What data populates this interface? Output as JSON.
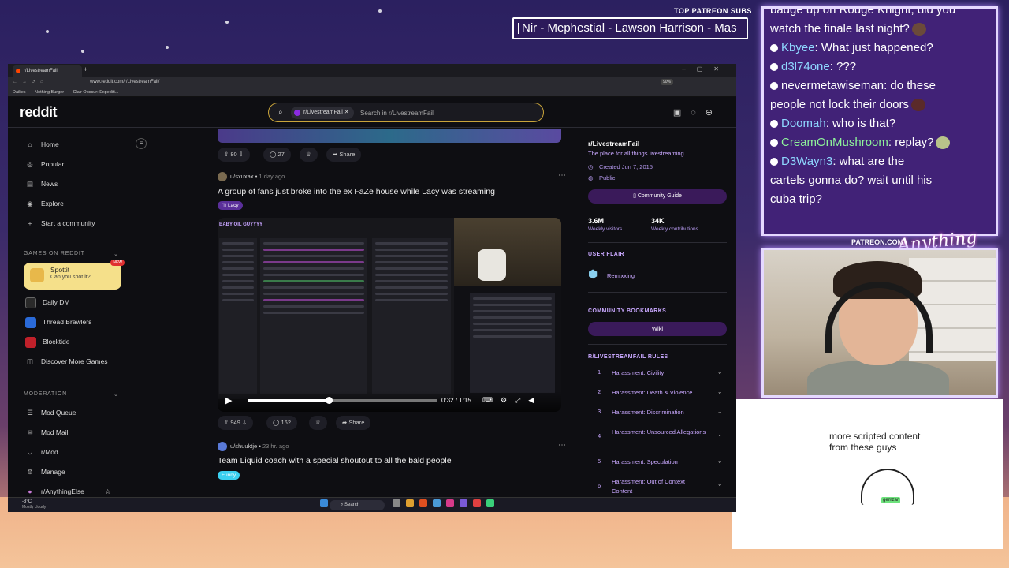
{
  "overlay": {
    "patreon_subs_title": "TOP PATREON SUBS",
    "ticker": "Nir - Mephestial - Lawson Harrison - Mas",
    "patreon_link": "PATREON.COM/",
    "brand_script": "Anything Else"
  },
  "chat": {
    "top_line": "badge up on Rouge Knight, did you",
    "messages": [
      {
        "user": "",
        "text": "watch the finale last night?",
        "color": "#ffffff",
        "emote_color": "#6b4a3a"
      },
      {
        "user": "Kbyee",
        "text": "What just happened?",
        "color": "#8fd8ff",
        "emote_color": ""
      },
      {
        "user": "d3l74one",
        "text": "???",
        "color": "#8fd8ff",
        "emote_color": ""
      },
      {
        "user": "nevermetawiseman",
        "text": "do these",
        "color": "#ffffff",
        "emote_color": ""
      },
      {
        "user": "",
        "text": "people not lock their doors",
        "color": "#ffffff",
        "emote_color": "#5a2a2a"
      },
      {
        "user": "Doomah",
        "text": "who is that?",
        "color": "#8fd8ff",
        "emote_color": ""
      },
      {
        "user": "CreamOnMushroom",
        "text": "replay?",
        "color": "#8ef39a",
        "emote_color": "#b8c28a"
      },
      {
        "user": "D3Wayn3",
        "text": "what are the",
        "color": "#8fd8ff",
        "emote_color": ""
      },
      {
        "user": "",
        "text": "cartels gonna do? wait until his",
        "color": "#ffffff",
        "emote_color": ""
      },
      {
        "user": "",
        "text": "cuba trip?",
        "color": "#ffffff",
        "emote_color": ""
      }
    ]
  },
  "note": {
    "text": "more scripted content from these guys",
    "badge": "gemzar"
  },
  "browser": {
    "tab_title": "r/LivestreamFail",
    "url": "www.reddit.com/r/LivestreamFail/",
    "zoom": "90%",
    "bookmarks": [
      "Dailies",
      "Nothing Burger",
      "Clair Obscur: Expediti..."
    ]
  },
  "reddit": {
    "logo": "reddit",
    "search_chip": "r/LivestreamFail",
    "search_placeholder": "Search in r/LivestreamFail",
    "nav": [
      {
        "label": "Home",
        "icon": "⌂"
      },
      {
        "label": "Popular",
        "icon": "◎"
      },
      {
        "label": "News",
        "icon": "▤"
      },
      {
        "label": "Explore",
        "icon": "◉"
      },
      {
        "label": "Start a community",
        "icon": "+"
      }
    ],
    "games_header": "GAMES ON REDDIT",
    "spottit": {
      "title": "Spottit",
      "sub": "Can you spot it?",
      "badge": "NEW"
    },
    "games": [
      {
        "label": "Daily DM",
        "color": "#2a2a2a"
      },
      {
        "label": "Thread Brawlers",
        "color": "#2a6ad8"
      },
      {
        "label": "Blocktide",
        "color": "#c0202a"
      },
      {
        "label": "Discover More Games",
        "color": ""
      }
    ],
    "moderation_header": "MODERATION",
    "mod_items": [
      "Mod Queue",
      "Mod Mail",
      "r/Mod",
      "Manage",
      "r/AnythingElse"
    ]
  },
  "posts": {
    "prev": {
      "votes": "80",
      "comments": "27",
      "share": "Share"
    },
    "post1": {
      "author": "u/sxuxax",
      "time": "1 day ago",
      "title": "A group of fans just broke into the ex FaZe house while Lacy was streaming",
      "flair": "Lacy",
      "video_header": "BABY OIL GUYYYY",
      "video_time": "0:32 / 1:15",
      "video_progress": 0.43,
      "votes": "949",
      "comments": "162",
      "share": "Share"
    },
    "post2": {
      "author": "u/shuuktje",
      "time": "23 hr. ago",
      "title": "Team Liquid coach with a special shoutout to all the bald people",
      "flair": "Funny"
    }
  },
  "rside": {
    "subreddit": "r/LivestreamFail",
    "description": "The place for all things livestreaming.",
    "created": "Created Jun 7, 2015",
    "visibility": "Public",
    "guide_button": "Community Guide",
    "visitors": "3.6M",
    "visitors_label": "Weekly visitors",
    "contributions": "34K",
    "contributions_label": "Weekly contributions",
    "user_flair_header": "USER FLAIR",
    "user_flair": "Remixxing",
    "bookmarks_header": "COMMUNITY BOOKMARKS",
    "wiki": "Wiki",
    "rules_header": "R/LIVESTREAMFAIL RULES",
    "rules": [
      {
        "n": "1",
        "t": "Harassment: Civility"
      },
      {
        "n": "2",
        "t": "Harassment: Death & Violence"
      },
      {
        "n": "3",
        "t": "Harassment: Discrimination"
      },
      {
        "n": "4",
        "t": "Harassment: Unsourced Allegations"
      },
      {
        "n": "5",
        "t": "Harassment: Speculation"
      },
      {
        "n": "6",
        "t": "Harassment: Out of Context Content"
      }
    ]
  },
  "taskbar": {
    "temp": "-3°C",
    "weather": "Mostly cloudy",
    "search": "Search"
  }
}
